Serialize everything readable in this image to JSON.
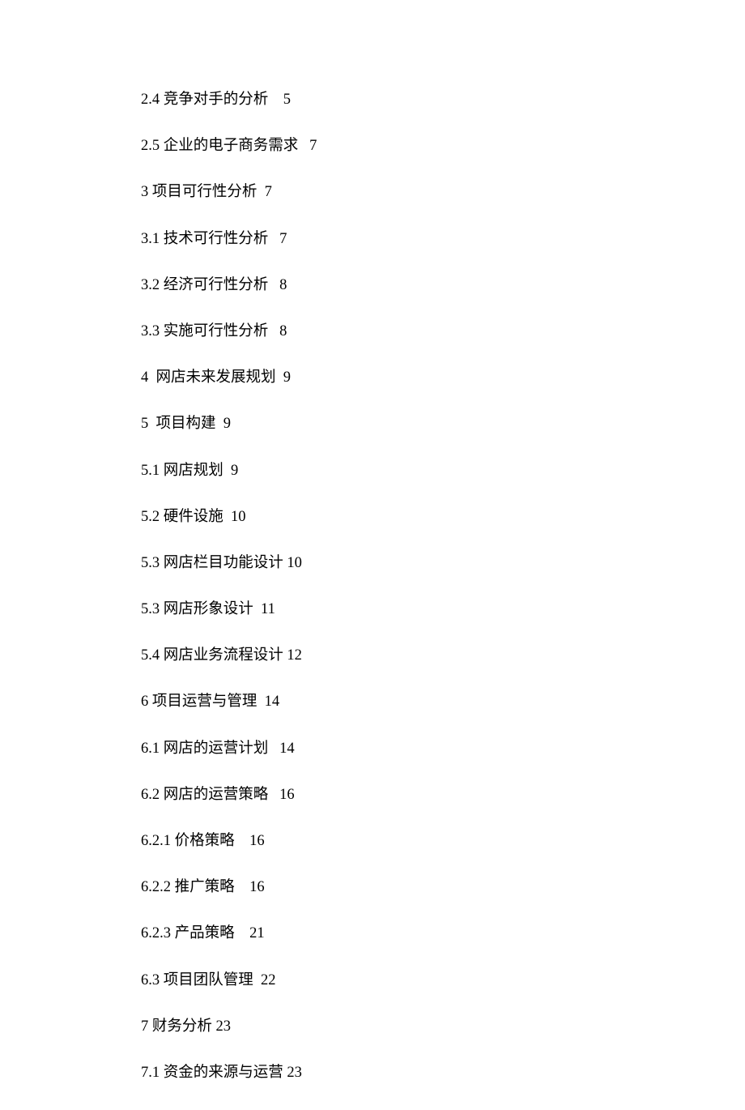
{
  "toc": [
    {
      "num": "2.4",
      "title": "竞争对手的分析",
      "page": "5",
      "gap1": " ",
      "gap2": "    "
    },
    {
      "num": "2.5",
      "title": "企业的电子商务需求",
      "page": "7",
      "gap1": " ",
      "gap2": "   "
    },
    {
      "num": "3",
      "title": "项目可行性分析",
      "page": "7",
      "gap1": " ",
      "gap2": "  "
    },
    {
      "num": "3.1",
      "title": "技术可行性分析",
      "page": "7",
      "gap1": " ",
      "gap2": "   "
    },
    {
      "num": "3.2",
      "title": "经济可行性分析",
      "page": "8",
      "gap1": " ",
      "gap2": "   "
    },
    {
      "num": "3.3",
      "title": "实施可行性分析",
      "page": "8",
      "gap1": " ",
      "gap2": "   "
    },
    {
      "num": "4",
      "title": "网店未来发展规划",
      "page": "9",
      "gap1": "  ",
      "gap2": "  "
    },
    {
      "num": "5",
      "title": "项目构建",
      "page": "9",
      "gap1": "  ",
      "gap2": "  "
    },
    {
      "num": "5.1",
      "title": "网店规划",
      "page": "9",
      "gap1": " ",
      "gap2": "  "
    },
    {
      "num": "5.2",
      "title": "硬件设施",
      "page": "10",
      "gap1": " ",
      "gap2": "  "
    },
    {
      "num": "5.3",
      "title": "网店栏目功能设计",
      "page": "10",
      "gap1": " ",
      "gap2": " "
    },
    {
      "num": "5.3",
      "title": "网店形象设计",
      "page": "11",
      "gap1": " ",
      "gap2": "  "
    },
    {
      "num": "5.4",
      "title": "网店业务流程设计",
      "page": "12",
      "gap1": " ",
      "gap2": " "
    },
    {
      "num": "6",
      "title": "项目运营与管理",
      "page": "14",
      "gap1": " ",
      "gap2": "  "
    },
    {
      "num": "6.1",
      "title": "网店的运营计划",
      "page": "14",
      "gap1": " ",
      "gap2": "   "
    },
    {
      "num": "6.2",
      "title": "网店的运营策略",
      "page": "16",
      "gap1": " ",
      "gap2": "   "
    },
    {
      "num": "6.2.1",
      "title": "价格策略",
      "page": "16",
      "gap1": " ",
      "gap2": "    "
    },
    {
      "num": "6.2.2",
      "title": "推广策略",
      "page": "16",
      "gap1": " ",
      "gap2": "    "
    },
    {
      "num": "6.2.3",
      "title": "产品策略",
      "page": "21",
      "gap1": " ",
      "gap2": "    "
    },
    {
      "num": "6.3",
      "title": "项目团队管理",
      "page": "22",
      "gap1": " ",
      "gap2": "  "
    },
    {
      "num": "7",
      "title": "财务分析",
      "page": "23",
      "gap1": " ",
      "gap2": " "
    },
    {
      "num": "7.1",
      "title": "资金的来源与运营",
      "page": "23",
      "gap1": " ",
      "gap2": " "
    }
  ]
}
